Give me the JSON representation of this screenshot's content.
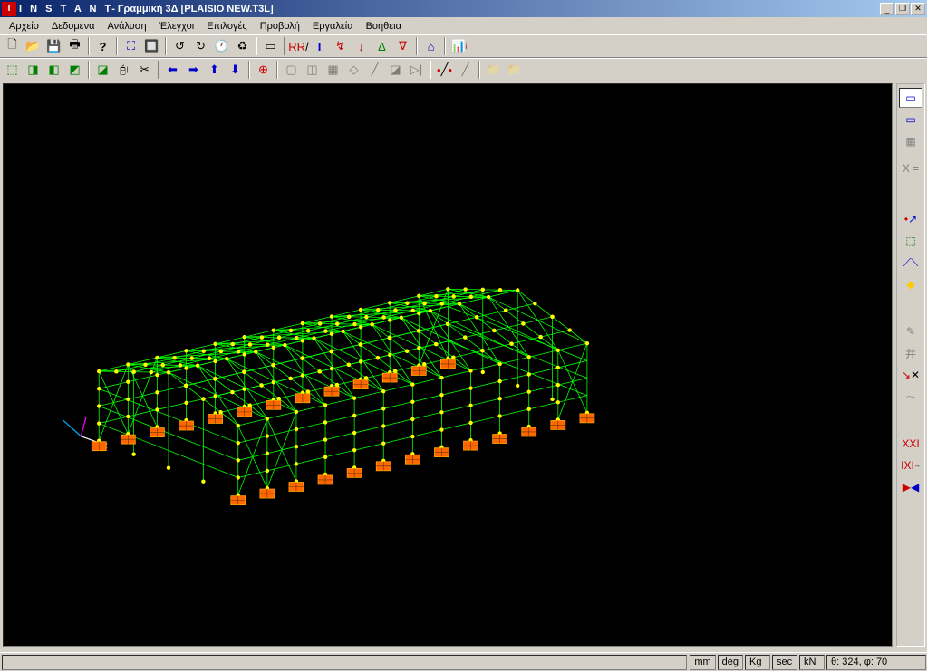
{
  "title": {
    "app": "I N S T A N T",
    "sub": " - Γραμμική 3Δ [PLAISIO NEW.T3L]"
  },
  "menu": {
    "file": "Αρχείο",
    "data": "Δεδομένα",
    "analysis": "Ανάλυση",
    "checks": "Έλεγχοι",
    "options": "Επιλογές",
    "view": "Προβολή",
    "tools": "Εργαλεία",
    "help": "Βοήθεια"
  },
  "right_panel": {
    "x_equals": "X ="
  },
  "status": {
    "unit_length": "mm",
    "unit_angle": "deg",
    "unit_mass": "Kg",
    "unit_time": "sec",
    "unit_force": "kN",
    "angles": "θ: 324, φ:  70"
  },
  "colors": {
    "titlebar_left": "#0a246a",
    "titlebar_right": "#a6caf0",
    "bg": "#d4d0c8",
    "viewport": "#000000",
    "wire_member": "#00ff00",
    "wire_node": "#ffff00",
    "support": "#ff6600",
    "axis_x": "#0088ff",
    "axis_y": "#ff00ff",
    "axis_text": "#ffffff"
  }
}
